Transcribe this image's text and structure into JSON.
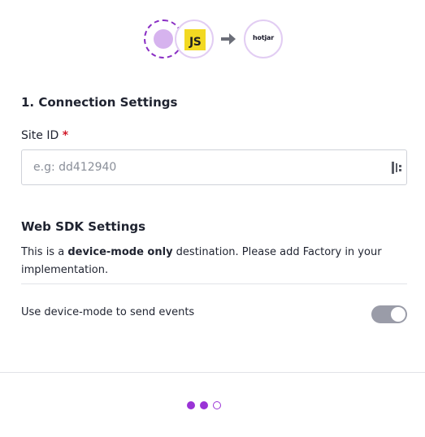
{
  "header": {
    "source_node": "source-icon",
    "js_logo_text": "JS",
    "arrow": "arrow-right-icon",
    "destination_logo_text": "hotjar"
  },
  "connection_settings": {
    "title": "1. Connection Settings",
    "site_id_label": "Site ID",
    "required_marker": "*",
    "site_id_value": "",
    "site_id_placeholder": "e.g: dd412940"
  },
  "web_sdk_settings": {
    "title": "Web SDK Settings",
    "description_prefix": "This is a ",
    "description_bold": "device-mode only",
    "description_suffix": " destination. Please add Factory in your implementation.",
    "toggle_label": "Use device-mode to send events",
    "toggle_on": true
  },
  "pager": {
    "total_steps": 3,
    "current_step": 2
  },
  "colors": {
    "accent": "#9a33d6",
    "toggle_track": "#9a9ca8",
    "required": "#d11a2a",
    "js_yellow": "#f2d922"
  }
}
